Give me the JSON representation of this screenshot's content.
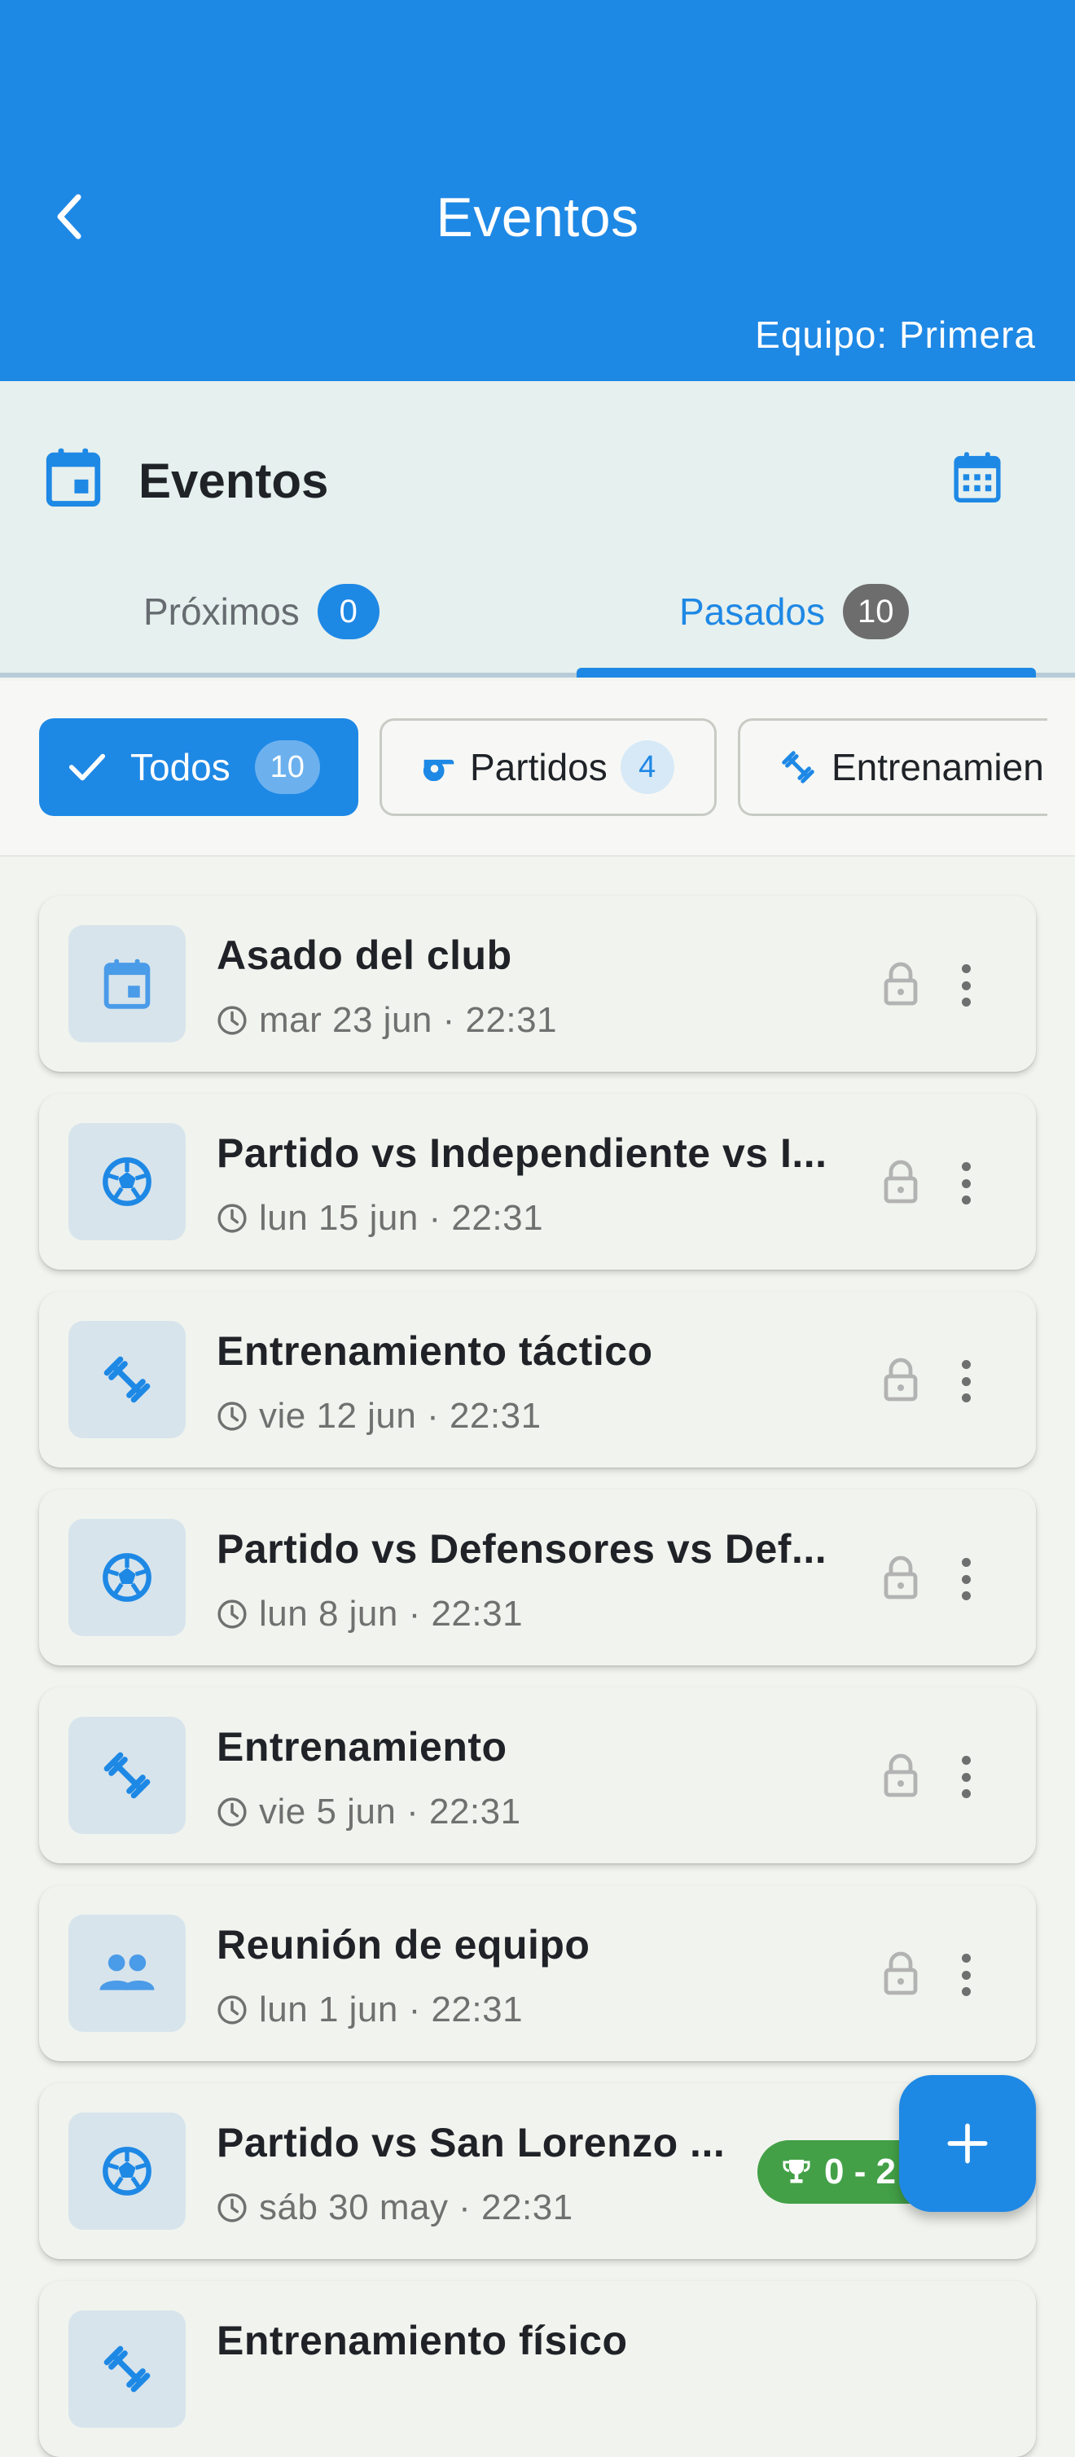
{
  "appbar": {
    "title": "Eventos",
    "subtitle": "Equipo: Primera"
  },
  "section": {
    "title": "Eventos"
  },
  "tabs": [
    {
      "label": "Próximos",
      "count": "0"
    },
    {
      "label": "Pasados",
      "count": "10",
      "selected": true
    }
  ],
  "filters": [
    {
      "label": "Todos",
      "count": "10",
      "selected": true,
      "icon": "check-icon"
    },
    {
      "label": "Partidos",
      "count": "4",
      "icon": "whistle-icon"
    },
    {
      "label": "Entrenamien",
      "icon": "fitness-icon"
    }
  ],
  "events": [
    {
      "title": "Asado del club",
      "date": "mar 23 jun · 22:31",
      "icon": "calendar-event-icon"
    },
    {
      "title": "Partido vs Independiente vs I...",
      "date": "lun 15 jun · 22:31",
      "icon": "soccer-ball-icon"
    },
    {
      "title": "Entrenamiento táctico",
      "date": "vie 12 jun · 22:31",
      "icon": "fitness-icon"
    },
    {
      "title": "Partido vs Defensores vs Def...",
      "date": "lun 8 jun · 22:31",
      "icon": "soccer-ball-icon"
    },
    {
      "title": "Entrenamiento",
      "date": "vie 5 jun · 22:31",
      "icon": "fitness-icon"
    },
    {
      "title": "Reunión de equipo",
      "date": "lun 1 jun · 22:31",
      "icon": "group-icon"
    },
    {
      "title": "Partido vs San Lorenzo ...",
      "date": "sáb 30 may · 22:31",
      "icon": "soccer-ball-icon",
      "score": "0 - 2"
    },
    {
      "title": "Entrenamiento físico",
      "date": "",
      "icon": "fitness-icon"
    }
  ],
  "colors": {
    "primary": "#1e88e5",
    "success": "#43a047",
    "background": "#f2f5ef"
  }
}
